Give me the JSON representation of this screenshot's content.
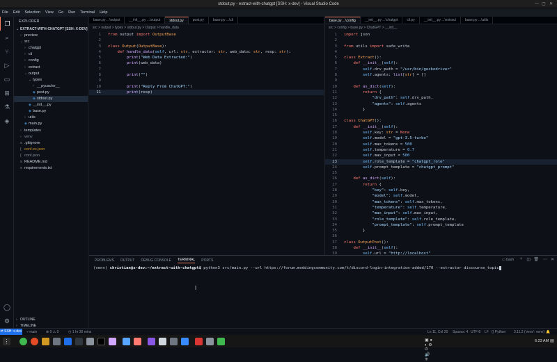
{
  "titlebar": {
    "title": "stdout.py - extract-with-chatgpt [SSH: x-dev] - Visual Studio Code"
  },
  "menu": [
    "File",
    "Edit",
    "Selection",
    "View",
    "Go",
    "Run",
    "Terminal",
    "Help"
  ],
  "sidebar": {
    "header": "EXPLORER",
    "root": "EXTRACT-WITH-CHATGPT [SSH: X-DEV]",
    "tree": [
      {
        "label": "preview",
        "depth": 1,
        "folder": true,
        "open": false
      },
      {
        "label": "src",
        "depth": 1,
        "folder": true,
        "open": true
      },
      {
        "label": "chatgpt",
        "depth": 2,
        "folder": true,
        "open": false
      },
      {
        "label": "cli",
        "depth": 2,
        "folder": true,
        "open": false
      },
      {
        "label": "config",
        "depth": 2,
        "folder": true,
        "open": false
      },
      {
        "label": "extract",
        "depth": 2,
        "folder": true,
        "open": false
      },
      {
        "label": "output",
        "depth": 2,
        "folder": true,
        "open": true
      },
      {
        "label": "types",
        "depth": 3,
        "folder": true,
        "open": true
      },
      {
        "label": "__pycache__",
        "depth": 4,
        "folder": true,
        "open": false
      },
      {
        "label": "post.py",
        "depth": 4,
        "folder": false
      },
      {
        "label": "stdout.py",
        "depth": 4,
        "folder": false,
        "selected": true
      },
      {
        "label": "__init__.py",
        "depth": 3,
        "folder": false
      },
      {
        "label": "base.py",
        "depth": 3,
        "folder": false
      },
      {
        "label": "utils",
        "depth": 2,
        "folder": true,
        "open": false
      },
      {
        "label": "main.py",
        "depth": 2,
        "folder": false
      },
      {
        "label": "templates",
        "depth": 1,
        "folder": true,
        "open": false
      },
      {
        "label": "venv",
        "depth": 1,
        "folder": true,
        "open": false,
        "dim": true
      },
      {
        "label": ".gitignore",
        "depth": 1,
        "folder": false
      },
      {
        "label": "conf.ex.json",
        "depth": 1,
        "folder": false,
        "yellow": true
      },
      {
        "label": "conf.json",
        "depth": 1,
        "folder": false,
        "dim": true
      },
      {
        "label": "README.md",
        "depth": 1,
        "folder": false
      },
      {
        "label": "requirements.txt",
        "depth": 1,
        "folder": false
      }
    ],
    "outline": "OUTLINE",
    "timeline": "TIMELINE"
  },
  "editor_left": {
    "tabs": [
      "base.py ...\\output",
      "__init__.py ...\\output",
      "stdout.py",
      "post.py",
      "base.py ...\\cli"
    ],
    "active_tab": 2,
    "breadcrumb": "src > output > types > stdout.py > Output > handle_data",
    "lines": [
      "from output import OutputBase",
      "",
      "class Output(OutputBase):",
      "    def handle_data(self, url: str, extractor: str, web_data: str, resp: str):",
      "        print(\"Web Data Extracted:\")",
      "        print(web_data)",
      "",
      "        print(\"\")",
      "",
      "        print(\"Reply From ChatGPT:\")",
      "        print(resp)"
    ],
    "current_line": 11
  },
  "editor_right": {
    "tabs": [
      "base.py ...\\config",
      "__init__.py ...\\chatgpt",
      "cli.py",
      "__init__.py ...\\extract",
      "base.py ...\\utils"
    ],
    "active_tab": 0,
    "breadcrumb": "src > config > base.py > ChatGPT > __init__",
    "lines": [
      "import json",
      "",
      "from utils import safe_write",
      "",
      "class Extract():",
      "    def __init__(self):",
      "        self.drv_path = \"/usr/bin/geckodriver\"",
      "        self.agents: list[str] = []",
      "",
      "    def as_dict(self):",
      "        return {",
      "            \"drv_path\": self.drv_path,",
      "            \"agents\": self.agents",
      "        }",
      "",
      "class ChatGPT():",
      "    def __init__(self):",
      "        self.key: str = None",
      "        self.model = \"gpt-3.5-turbo\"",
      "        self.max_tokens = 500",
      "        self.temperature = 0.7",
      "        self.max_input = 500",
      "        self.role_template = \"chatgpt_role\"",
      "        self.prompt_template = \"chatgpt_prompt\"",
      "",
      "    def as_dict(self):",
      "        return {",
      "            \"key\": self.key,",
      "            \"model\": self.model,",
      "            \"max_tokens\": self.max_tokens,",
      "            \"temperature\": self.temperature,",
      "            \"max_input\": self.max_input,",
      "            \"role_template\": self.role_template,",
      "            \"prompt_template\": self.prompt_template",
      "        }",
      "",
      "class OutputPost():",
      "    def __init__(self):",
      "        self.url = \"http://localhost\"",
      "        self.headers: dict[str, str] = {}"
    ],
    "current_line": 23
  },
  "panel": {
    "tabs": [
      "PROBLEMS",
      "OUTPUT",
      "DEBUG CONSOLE",
      "TERMINAL",
      "PORTS"
    ],
    "active_tab": 3,
    "shell": "bash",
    "prompt_prefix": "(venv) ",
    "prompt_user": "christian@x-dev",
    "prompt_path": ":~/extract-with-chatgpt$",
    "command": " python3 src/main.py --url https://forum.moddingcommunity.com/t/discord-login-integration-added/170 --extractor discourse_topic"
  },
  "status": {
    "remote": "SSH: x-dev",
    "branch": "main",
    "errors": "0",
    "warnings": "0",
    "time": "1 hr 30 mins",
    "position": "Ln 11, Col 20",
    "spaces": "Spaces: 4",
    "encoding": "UTF-8",
    "eol": "LF",
    "language": "Python",
    "interpreter": "3.11.2 ('venv': venv)"
  },
  "clock": "6:23 AM",
  "colors": {
    "accent": "#f78166",
    "remote": "#1f6feb"
  }
}
